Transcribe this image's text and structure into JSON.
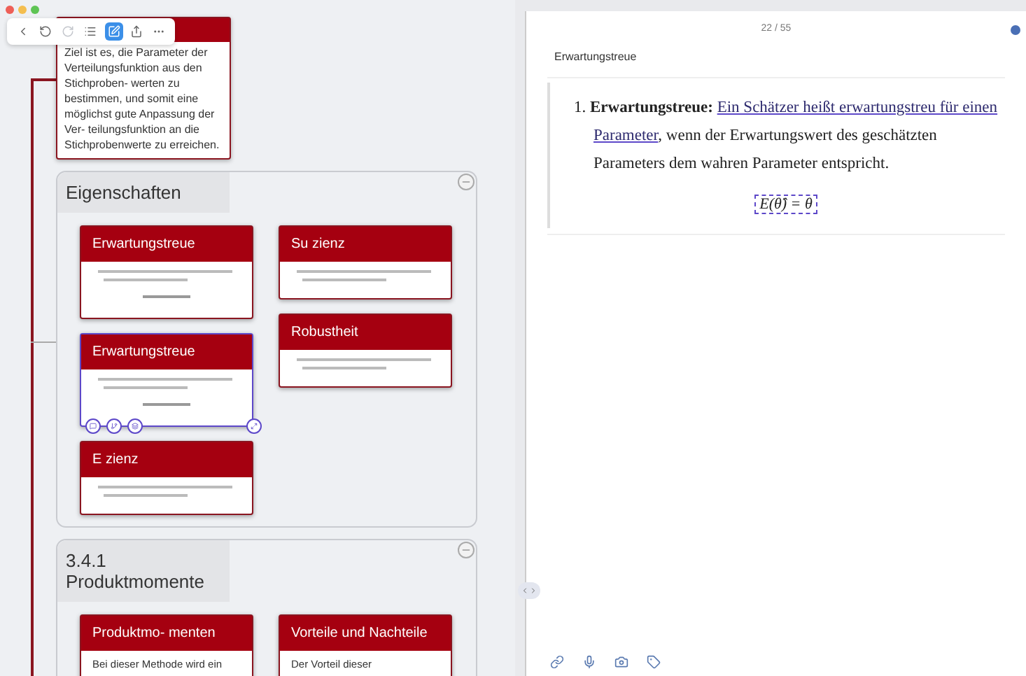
{
  "toolbar": {
    "buttons": [
      {
        "kind": "back",
        "selected": false,
        "disabled": false
      },
      {
        "kind": "undo",
        "selected": false,
        "disabled": false
      },
      {
        "kind": "redo",
        "selected": false,
        "disabled": true
      },
      {
        "kind": "list",
        "selected": false,
        "disabled": false
      },
      {
        "kind": "edit",
        "selected": true,
        "disabled": false
      },
      {
        "kind": "share",
        "selected": false,
        "disabled": false
      },
      {
        "kind": "more",
        "selected": false,
        "disabled": false
      }
    ]
  },
  "mindmap": {
    "intro_card": {
      "text": "Ziel ist es, die Parameter der Verteilungsfunktion aus den Stichproben- werten zu bestimmen, und somit eine möglichst gute Anpassung der Ver- teilungsfunktion an die Stichprobenwerte zu erreichen."
    },
    "groups": [
      {
        "title": "Eigenschaften",
        "columns": [
          [
            {
              "title": "Erwartungstreue",
              "selected": false,
              "formula": true
            },
            {
              "title": "Erwartungstreue",
              "selected": true,
              "formula": true
            },
            {
              "title": "E zienz",
              "selected": false,
              "formula": false
            }
          ],
          [
            {
              "title": "Su zienz",
              "selected": false,
              "formula": false
            },
            {
              "title": "Robustheit",
              "selected": false,
              "formula": false
            }
          ]
        ]
      },
      {
        "title": "3.4.1 Produktmomente",
        "columns": [
          [
            {
              "title": "Produktmo- menten",
              "selected": false,
              "text": "Bei dieser Methode wird ein"
            }
          ],
          [
            {
              "title": "Vorteile und Nachteile",
              "selected": false,
              "text": "Der Vorteil dieser"
            }
          ]
        ]
      }
    ]
  },
  "detail": {
    "page": "22 / 55",
    "title": "Erwartungstreue",
    "item": {
      "number": "1.",
      "term": "Erwartungstreue:",
      "underlined": "Ein Schätzer heißt erwartungstreu für einen Parameter",
      "rest": ", wenn der Erwartungswert des geschätzten Parameters dem wahren Parameter entspricht."
    },
    "formula": "E(θ̂) = θ",
    "tools": [
      {
        "kind": "link"
      },
      {
        "kind": "mic"
      },
      {
        "kind": "camera"
      },
      {
        "kind": "tag"
      }
    ]
  }
}
